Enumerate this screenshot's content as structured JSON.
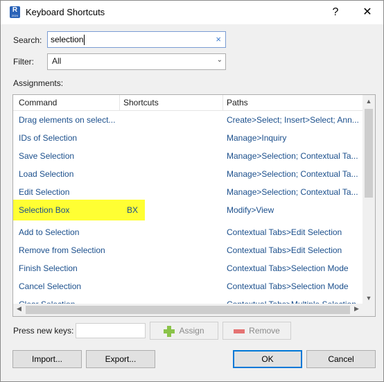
{
  "window": {
    "title": "Keyboard Shortcuts",
    "icon_letter": "R",
    "icon_sub": "2024",
    "help_glyph": "?",
    "close_glyph": "✕"
  },
  "search": {
    "label": "Search:",
    "value": "selection",
    "clear_glyph": "×"
  },
  "filter": {
    "label": "Filter:",
    "value": "All",
    "chevron_glyph": "⌄"
  },
  "assignments": {
    "label": "Assignments:",
    "columns": [
      "Command",
      "Shortcuts",
      "Paths"
    ],
    "rows": [
      {
        "command": "Drag elements on select...",
        "shortcut": "",
        "path": "Create>Select; Insert>Select; Ann..."
      },
      {
        "command": "IDs of Selection",
        "shortcut": "",
        "path": "Manage>Inquiry"
      },
      {
        "command": "Save Selection",
        "shortcut": "",
        "path": "Manage>Selection; Contextual Ta..."
      },
      {
        "command": "Load Selection",
        "shortcut": "",
        "path": "Manage>Selection; Contextual Ta..."
      },
      {
        "command": "Edit Selection",
        "shortcut": "",
        "path": "Manage>Selection; Contextual Ta..."
      },
      {
        "command": "Selection Box",
        "shortcut": "BX",
        "path": "Modify>View"
      },
      {
        "command": "Add to Selection",
        "shortcut": "",
        "path": "Contextual Tabs>Edit Selection"
      },
      {
        "command": "Remove from Selection",
        "shortcut": "",
        "path": "Contextual Tabs>Edit Selection"
      },
      {
        "command": "Finish Selection",
        "shortcut": "",
        "path": "Contextual Tabs>Selection Mode"
      },
      {
        "command": "Cancel Selection",
        "shortcut": "",
        "path": "Contextual Tabs>Selection Mode"
      },
      {
        "command": "Clear Selection",
        "shortcut": "",
        "path": "Contextual Tabs>Multiple Selection"
      }
    ],
    "highlight_color": "#ffff33",
    "scroll_up_glyph": "▲",
    "scroll_down_glyph": "▼",
    "scroll_left_glyph": "◀",
    "scroll_right_glyph": "▶"
  },
  "new_keys": {
    "label": "Press new keys:",
    "value": ""
  },
  "buttons": {
    "assign": "Assign",
    "remove": "Remove",
    "import": "Import...",
    "export": "Export...",
    "ok": "OK",
    "cancel": "Cancel"
  }
}
